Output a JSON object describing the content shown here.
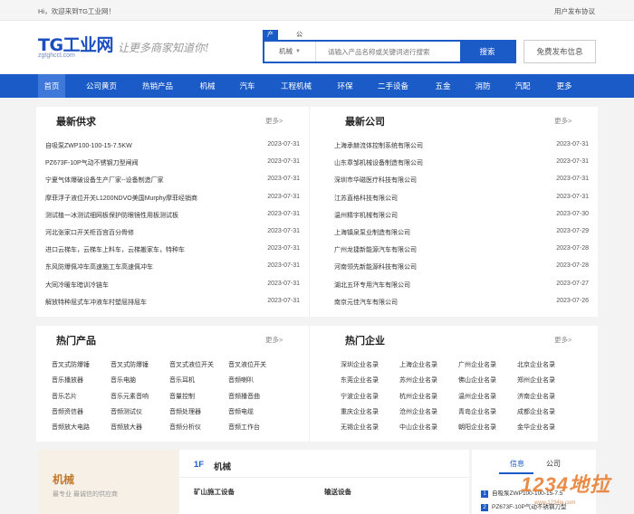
{
  "topbar": {
    "welcome": "Hi，欢迎来到TG工业网！",
    "agreement": "用户发布协议"
  },
  "header": {
    "logo": "TG工业网",
    "logo_url": "zgtghccl.com",
    "slogan": "让更多商家知道你!"
  },
  "search": {
    "tabs": [
      "产品",
      "公司"
    ],
    "select": "机械",
    "placeholder": "请输入产品名称或关键词进行搜索",
    "button": "搜索",
    "publish": "免费发布信息"
  },
  "nav": [
    "首页",
    "公司黄页",
    "热销产品",
    "机械",
    "汽车",
    "工程机械",
    "环保",
    "二手设备",
    "五金",
    "消防",
    "汽配",
    "更多"
  ],
  "supply": {
    "title": "最新供求",
    "more": "更多>",
    "items": [
      {
        "name": "自吸泵ZWP100-100-15-7.5KW",
        "date": "2023-07-31"
      },
      {
        "name": "PZ673F-10P气动不锈钢刀型闸阀",
        "date": "2023-07-31"
      },
      {
        "name": "宁夏气体爆破设备生产厂家--设备制造厂家",
        "date": "2023-07-31"
      },
      {
        "name": "摩菲浮子液位开关L1200NDVO美国Murphy摩菲经销商",
        "date": "2023-07-31"
      },
      {
        "name": "测试植一冰测试细网板保护防眼镜性用板测试板",
        "date": "2023-07-31"
      },
      {
        "name": "河北张家口开关柜百宫百分骨修",
        "date": "2023-07-31"
      },
      {
        "name": "进口云梯车，云梯车上料车，云梯搬家车，特种车",
        "date": "2023-07-31"
      },
      {
        "name": "东风防爆佩冲车高速施工车高速佩冲车",
        "date": "2023-07-31"
      },
      {
        "name": "大同冷暖车暗训冷链车",
        "date": "2023-07-31"
      },
      {
        "name": "解放特种屈式车冲液车村塑屈排屈车",
        "date": "2023-07-31"
      }
    ]
  },
  "companies": {
    "title": "最新公司",
    "more": "更多>",
    "items": [
      {
        "name": "上海承赫流体控制系统有限公司",
        "date": "2023-07-31"
      },
      {
        "name": "山东章邹机械设备制造有限公司",
        "date": "2023-07-31"
      },
      {
        "name": "深圳市华磁医疗科技有限公司",
        "date": "2023-07-31"
      },
      {
        "name": "江苏直格科技有限公司",
        "date": "2023-07-31"
      },
      {
        "name": "温州精宇机械有限公司",
        "date": "2023-07-30"
      },
      {
        "name": "上海镇泉泵业制造有限公司",
        "date": "2023-07-29"
      },
      {
        "name": "广州龙捷新能源汽车有限公司",
        "date": "2023-07-28"
      },
      {
        "name": "河南领先新能源科技有限公司",
        "date": "2023-07-28"
      },
      {
        "name": "湖北五环专用汽车有限公司",
        "date": "2023-07-27"
      },
      {
        "name": "南京元佳汽车有限公司",
        "date": "2023-07-26"
      }
    ]
  },
  "hot_products": {
    "title": "热门产品",
    "more": "更多>",
    "items": [
      "音叉式防爆锤",
      "音叉式防爆锤",
      "音叉式液位开关",
      "音叉液位开关",
      "音乐播放器",
      "音乐电脑",
      "音乐耳机",
      "音频喇叭",
      "音乐芯片",
      "音乐元素音响",
      "音量控制",
      "音频播音曲",
      "音频资信器",
      "音频测试仪",
      "音频处理器",
      "音频电缆",
      "音频放大电路",
      "音频放大器",
      "音频分析仪",
      "音频工作台"
    ]
  },
  "hot_companies": {
    "title": "热门企业",
    "more": "更多>",
    "items": [
      "深圳企业名录",
      "上海企业名录",
      "广州企业名录",
      "北京企业名录",
      "东莞企业名录",
      "苏州企业名录",
      "佛山企业名录",
      "郑州企业名录",
      "宁波企业名录",
      "杭州企业名录",
      "温州企业名录",
      "济南企业名录",
      "重庆企业名录",
      "沧州企业名录",
      "青岛企业名录",
      "成都企业名录",
      "无锡企业名录",
      "中山企业名录",
      "朝阳企业名录",
      "金华企业名录"
    ]
  },
  "floor": {
    "category": "机械",
    "sub": "最专业 最诚信的供应商",
    "num": "1F",
    "name": "机械",
    "groups": [
      "矿山施工设备",
      "输送设备"
    ],
    "tabs": [
      "信息",
      "公司"
    ],
    "list": [
      {
        "num": "1",
        "text": "自吸泵ZWP100-100-15-7.5"
      },
      {
        "num": "2",
        "text": "PZ673F-10P气动不锈钢刀型"
      }
    ]
  },
  "watermark": {
    "main": "1234地拉",
    "sub": "www.1234la.com"
  },
  "colors": {
    "brand": "#1b5bc8",
    "accent": "#c17a2c"
  }
}
